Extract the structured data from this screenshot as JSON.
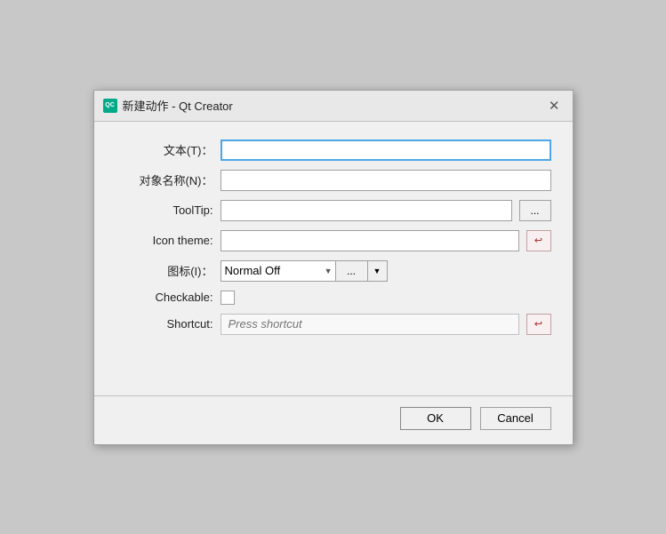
{
  "dialog": {
    "title": "新建动作 - Qt Creator",
    "icon_label": "QC",
    "close_label": "✕"
  },
  "form": {
    "text_label": "文本(T)：",
    "text_value": "",
    "object_name_label": "对象名称(N)：",
    "object_name_value": "",
    "tooltip_label": "ToolTip:",
    "tooltip_value": "",
    "tooltip_btn": "...",
    "icon_theme_label": "Icon theme:",
    "icon_theme_value": "",
    "icon_theme_reset_icon": "↩",
    "icon_label": "图标(I)：",
    "icon_dropdown_value": "Normal Off",
    "icon_dots_btn": "...",
    "checkable_label": "Checkable:",
    "shortcut_label": "Shortcut:",
    "shortcut_placeholder": "Press shortcut",
    "shortcut_reset_icon": "↩"
  },
  "footer": {
    "ok_label": "OK",
    "cancel_label": "Cancel"
  }
}
